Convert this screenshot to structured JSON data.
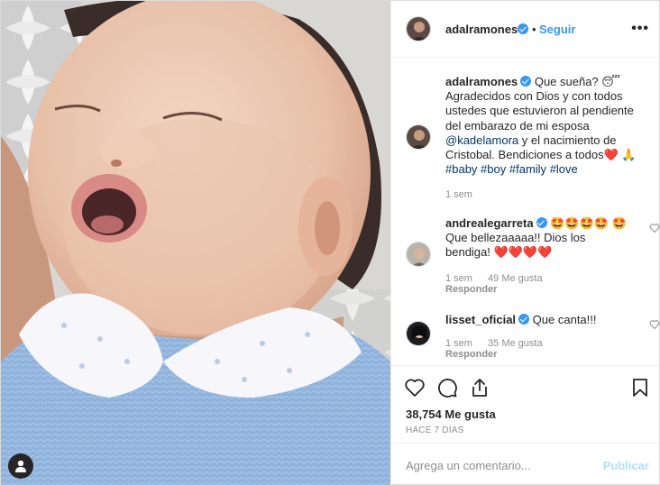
{
  "post": {
    "author": "adalramones",
    "follow_label": "Seguir",
    "separator": "•",
    "more_label": "•••"
  },
  "comments": [
    {
      "username": "adalramones",
      "verified": true,
      "text": "Que sueña? 😴 Agradecidos con Dios y con todos ustedes que estuvieron al pendiente del embarazo de mi esposa",
      "mention": "@kadelamora",
      "text2": "y el nacimiento de Cristobal. Bendiciones a todos❤️ 🙏",
      "hashtags": [
        "#baby",
        "#boy",
        "#family",
        "#love"
      ],
      "time": "1 sem"
    },
    {
      "username": "andrealegarreta",
      "verified": true,
      "text": "🤩🤩🤩🤩 🤩 Que bellezaaaaa!! Dios los bendiga! ❤️❤️❤️❤️",
      "time": "1 sem",
      "likes": "49 Me gusta",
      "reply": "Responder"
    },
    {
      "username": "lisset_oficial",
      "verified": true,
      "text": "Que canta!!!",
      "time": "1 sem",
      "likes": "35 Me gusta",
      "reply": "Responder"
    }
  ],
  "stats": {
    "likes": "38,754 Me gusta",
    "time_ago": "HACE 7 DÍAS"
  },
  "comment_box": {
    "placeholder": "Agrega un comentario...",
    "publish_label": "Publicar"
  },
  "colors": {
    "link_blue": "#3897f0",
    "hashtag": "#003569",
    "muted": "#8e8e8e",
    "publish_disabled": "#b2dffc",
    "onesie_blue": "#8fb3dc"
  },
  "icons": [
    "heart-icon",
    "comment-icon",
    "share-icon",
    "bookmark-icon",
    "user-tag-icon",
    "verified-icon",
    "more-icon"
  ]
}
